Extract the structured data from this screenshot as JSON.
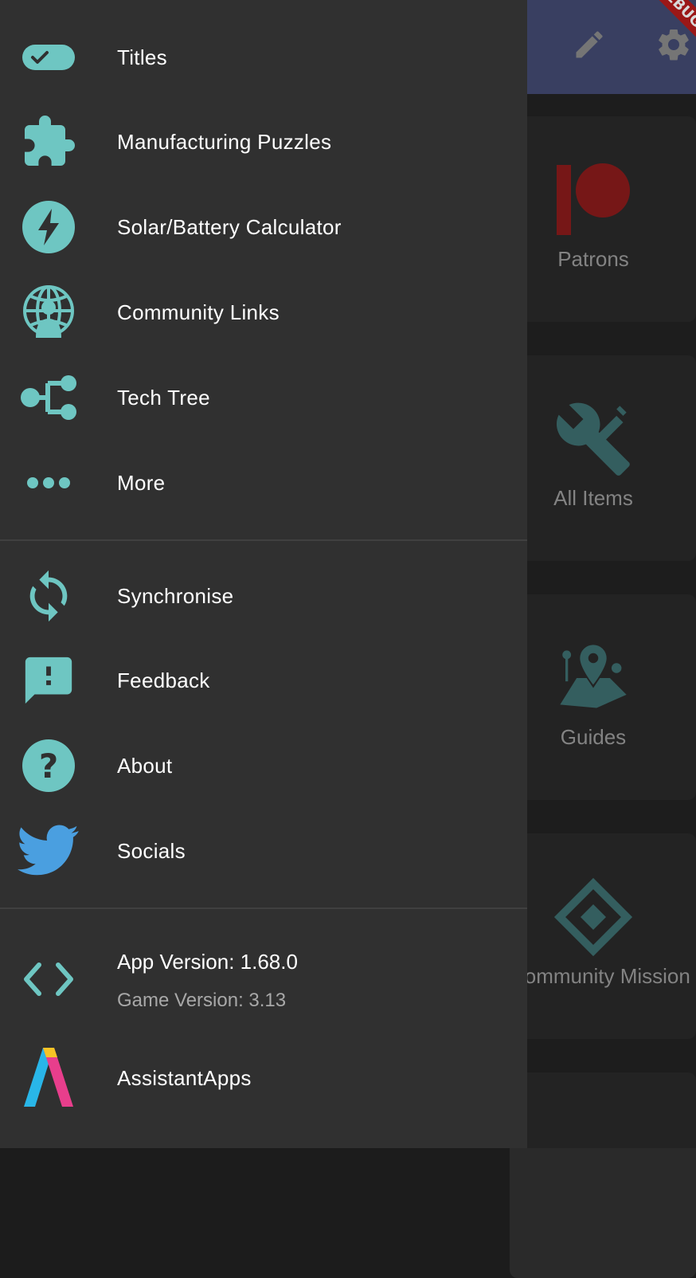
{
  "colors": {
    "accent": "#6ec6c2",
    "drawer_bg": "#303030",
    "appbar_bg": "#434a72",
    "twitter": "#4a9fe0",
    "patreon": "#8b1c1c",
    "tile_icon": "#3e6f70"
  },
  "debug_banner": "DEBUG",
  "drawer": {
    "group1": [
      {
        "label": "Titles",
        "icon": "badge-check-icon"
      },
      {
        "label": "Manufacturing Puzzles",
        "icon": "puzzle-icon"
      },
      {
        "label": "Solar/Battery Calculator",
        "icon": "bolt-icon"
      },
      {
        "label": "Community Links",
        "icon": "globe-person-icon"
      },
      {
        "label": "Tech Tree",
        "icon": "tree-icon"
      },
      {
        "label": "More",
        "icon": "more-dots-icon"
      }
    ],
    "group2": [
      {
        "label": "Synchronise",
        "icon": "sync-icon"
      },
      {
        "label": "Feedback",
        "icon": "feedback-icon"
      },
      {
        "label": "About",
        "icon": "help-icon"
      },
      {
        "label": "Socials",
        "icon": "twitter-icon"
      }
    ],
    "app_version": "App Version: 1.68.0",
    "game_version": "Game Version: 3.13",
    "assistant_apps": "AssistantApps"
  },
  "background": {
    "tiles": [
      {
        "label": "Patrons"
      },
      {
        "label": "All Items"
      },
      {
        "label": "Guides"
      },
      {
        "label": "Community Mission"
      }
    ]
  }
}
